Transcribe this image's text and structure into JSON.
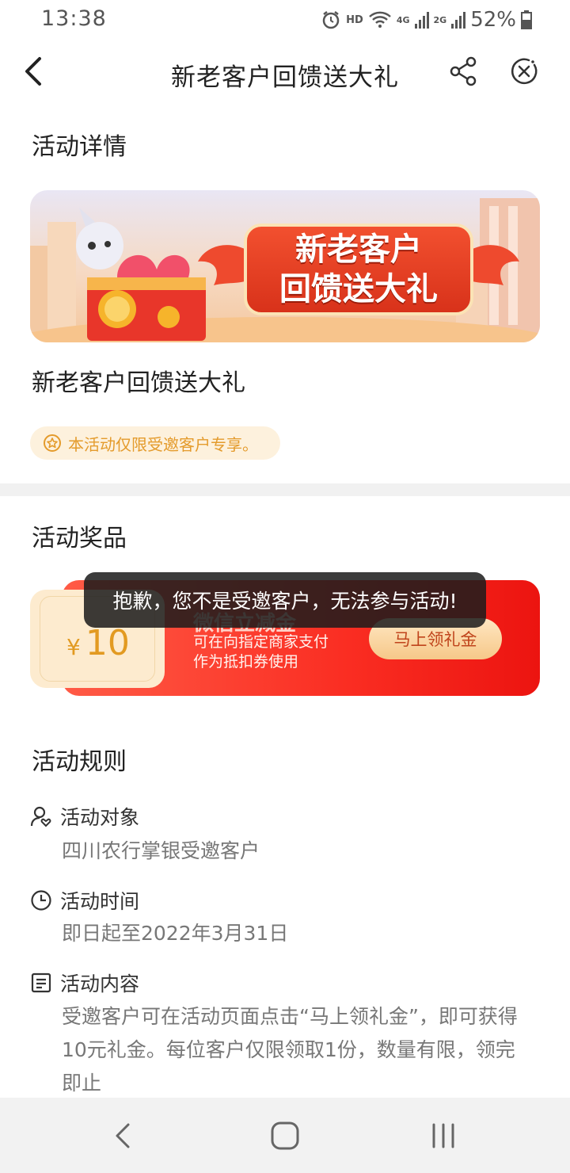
{
  "status_bar": {
    "time": "13:38",
    "hd": "HD",
    "net1": "4G",
    "net2": "2G",
    "battery": "52%"
  },
  "header": {
    "title": "新老客户回馈送大礼"
  },
  "details": {
    "section_title": "活动详情",
    "banner_line1": "新老客户",
    "banner_line2": "回馈送大礼",
    "activity_name": "新老客户回馈送大礼",
    "notice": "本活动仅限受邀客户专享。"
  },
  "prizes": {
    "section_title": "活动奖品",
    "coupon": {
      "currency": "¥",
      "amount": "10",
      "name": "微信立减金",
      "desc": "可在向指定商家支付作为抵扣券使用",
      "button": "马上领礼金"
    }
  },
  "toast": "抱歉，您不是受邀客户，无法参与活动!",
  "rules": {
    "section_title": "活动规则",
    "target_label": "活动对象",
    "target_value": "四川农行掌银受邀客户",
    "time_label": "活动时间",
    "time_value": "即日起至2022年3月31日",
    "content_label": "活动内容",
    "content_value": "受邀客户可在活动页面点击“马上领礼金”，即可获得10元礼金。每位客户仅限领取1份，数量有限，领完即止"
  },
  "colors": {
    "accent_red": "#fa2d22",
    "gold": "#e29a21",
    "notice_bg": "#fdf1dd"
  }
}
